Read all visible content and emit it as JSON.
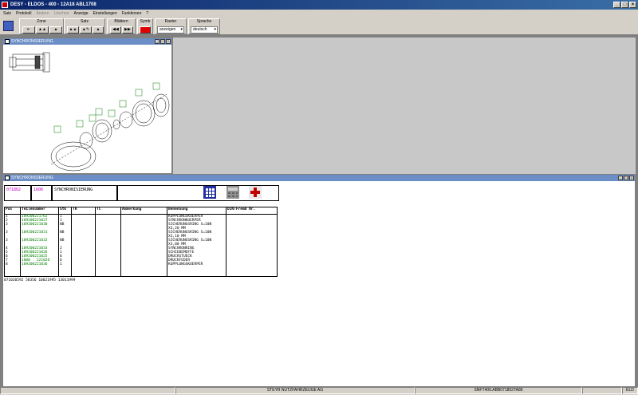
{
  "window": {
    "title": "DESY - ELDOS - 400 - 12A18 ABL1708"
  },
  "menu": [
    "Satz",
    "Protokoll",
    "Ändern",
    "Löschen",
    "Anzeige",
    "Einstellungen",
    "Funktionen",
    "?"
  ],
  "toolbar": {
    "groups": {
      "zone": "Zone",
      "satz": "Satz",
      "blaettern": "Blättern",
      "symb": "Symb",
      "raster": "Raster",
      "sprache": "Sprache"
    },
    "raster_value": "anzeigen",
    "sprache_value": "deutsch"
  },
  "drawing_window": {
    "title": "SYNCHRONISIERUNG"
  },
  "parts_window": {
    "title": "SYNCHRONISIERUNG"
  },
  "header": {
    "code1": "071802",
    "code2": "1606",
    "description": "SYNCHRONISIERUNG"
  },
  "table": {
    "headers": [
      "Pos",
      "Teilenummer",
      "Stk",
      "TR",
      "TC",
      "Anmerkung",
      "Benennung",
      "DIN/Fremd Nr."
    ],
    "pos": "1\n2\n3\n\n3\n\n3\n\n4\n5\n6\n7\n8",
    "teilenummer": "109200221762\n109200221027\n109200221030\n\n109200221031\n\n109200221032\n\n109200221033\n109200221026\n109200221025\n1000   221026\n109200221036",
    "stk": "1\n1\nNB\n\nNB\n\nNB\n\n2\n1\n6\n6\n1",
    "benennung": "KUPPLUNGSKOERPER\nSYNCHRONKOERPER\nSICHERUNGSRING S=10N\nX3,20 MM\nSICHERUNGSRING S=10N\nX3,10 MM\nSICHERUNGSRING S=10N\nX3,00 MM\nSYNCHRONRING\nSCHIEBEMUFFE\nDRUCKSTUECK\nDRUCKFEDER\nKUPPLUNGSKOERPER"
  },
  "footnote": "071020592 58356 10021995 13011999",
  "status": {
    "center": "STEYR NUTZFAHRZEUGE AG",
    "right": "SNFT400.ABB071802TA86",
    "far_right": "ELD"
  }
}
